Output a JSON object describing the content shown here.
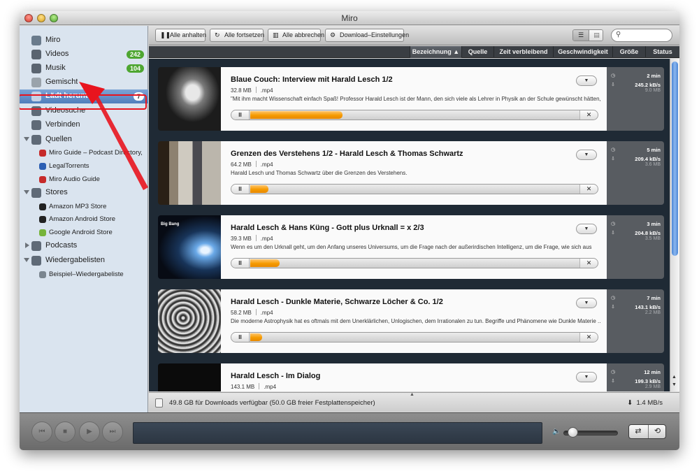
{
  "window": {
    "title": "Miro"
  },
  "sidebar": {
    "items": [
      {
        "label": "Miro",
        "icon": "miro-icon",
        "color": "#6a7b8c"
      },
      {
        "label": "Videos",
        "icon": "film-icon",
        "badge": "242",
        "color": "#5a6470"
      },
      {
        "label": "Musik",
        "icon": "music-icon",
        "badge": "104",
        "color": "#5a6470"
      },
      {
        "label": "Gemischt",
        "icon": "document-icon",
        "color": "#9aa3ab"
      },
      {
        "label": "Lädt herunter",
        "icon": "download-icon",
        "badge": "7",
        "color": "#c7d3e6"
      },
      {
        "label": "Videosuche",
        "icon": "magnifier-icon",
        "color": "#5f6a77"
      },
      {
        "label": "Verbinden",
        "icon": "share-icon",
        "color": "#5f6a77"
      },
      {
        "label": "Quellen",
        "icon": "globe-icon",
        "color": "#5f6a77"
      },
      {
        "label": "Miro Guide – Podcast Directory, V...",
        "icon": "miro-guide-icon",
        "color": "#c62a2a"
      },
      {
        "label": "LegalTorrents",
        "icon": "legaltorrents-icon",
        "color": "#2c5fb3"
      },
      {
        "label": "Miro Audio Guide",
        "icon": "miro-audio-icon",
        "color": "#c62a2a"
      },
      {
        "label": "Stores",
        "icon": "cart-icon",
        "color": "#5f6a77"
      },
      {
        "label": "Amazon MP3 Store",
        "icon": "amazon-icon",
        "color": "#222222"
      },
      {
        "label": "Amazon Android Store",
        "icon": "amazon-icon",
        "color": "#222222"
      },
      {
        "label": "Google Android Store",
        "icon": "android-icon",
        "color": "#76b43a"
      },
      {
        "label": "Podcasts",
        "icon": "podcast-icon",
        "color": "#5f6a77"
      },
      {
        "label": "Wiedergabelisten",
        "icon": "playlist-icon",
        "color": "#5f6a77"
      },
      {
        "label": "Beispiel–Wiedergabeliste",
        "icon": "playlist-item-icon",
        "color": "#7b8690"
      }
    ]
  },
  "toolbar": {
    "pause_all": "Alle anhalten",
    "resume_all": "Alle fortsetzen",
    "cancel_all": "Alle abbrechen",
    "download_settings": "Download–Einstellungen",
    "search_placeholder": ""
  },
  "columns": [
    "Bezeichnung ▲",
    "Quelle",
    "Zeit verbleibend",
    "Geschwindigkeit",
    "Größe",
    "Status"
  ],
  "downloads": [
    {
      "title": "Blaue Couch: Interview mit Harald Lesch 1/2",
      "size": "32.8 MB",
      "format": ".mp4",
      "description": "\"Mit ihm macht Wissenschaft einfach Spaß! Professor Harald Lesch ist der Mann, den sich viele als Lehrer in Physik an der Schule gewünscht hätten,",
      "progress": 0.28,
      "time_left": "2 min",
      "speed": "245.2 kB/s",
      "total": "9.0 MB"
    },
    {
      "title": "Grenzen des Verstehens 1/2 - Harald Lesch & Thomas Schwartz",
      "size": "64.2 MB",
      "format": ".mp4",
      "description": "Harald Lesch und Thomas Schwartz über die Grenzen des Verstehens.",
      "progress": 0.055,
      "time_left": "5 min",
      "speed": "209.4 kB/s",
      "total": "3.6 MB"
    },
    {
      "title": "Harald Lesch & Hans Küng - Gott plus Urknall = x 2/3",
      "size": "39.3 MB",
      "format": ".mp4",
      "description": "Wenn es um den Urknall geht, um den Anfang unseres Universums, um die Frage nach der außerirdischen Intelligenz, um die Frage, wie sich aus",
      "progress": 0.088,
      "time_left": "3 min",
      "speed": "204.8 kB/s",
      "total": "3.5 MB",
      "thumb_label": "Big Bang"
    },
    {
      "title": "Harald Lesch - Dunkle Materie, Schwarze Löcher & Co. 1/2",
      "size": "58.2 MB",
      "format": ".mp4",
      "description": "Die moderne Astrophysik hat es oftmals mit dem Unerklärlichen, Unlogischen, dem Irrationalen zu tun. Begriffe und Phänomene wie Dunkle Materie ...",
      "progress": 0.037,
      "time_left": "7 min",
      "speed": "143.1 kB/s",
      "total": "2.2 MB"
    },
    {
      "title": "Harald Lesch - Im Dialog",
      "size": "143.1 MB",
      "format": ".mp4",
      "description": "",
      "progress": 0.02,
      "time_left": "12 min",
      "speed": "199.3 kB/s",
      "total": "2.9 MB"
    }
  ],
  "statusbar": {
    "space": "49.8 GB für Downloads verfügbar (50.0 GB freier Festplattenspeicher)",
    "rate": "1.4 MB/s"
  },
  "player": {
    "volume": 0.12
  },
  "glyphs": {
    "pause": "II",
    "cancel": "✕",
    "menu": "▼",
    "clock": "◷",
    "down": "⇩"
  }
}
